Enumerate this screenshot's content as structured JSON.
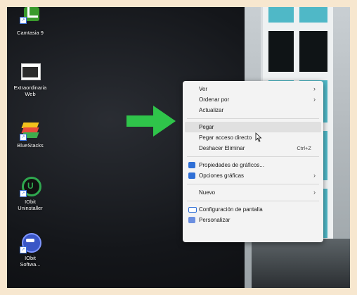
{
  "desktop_icons": [
    {
      "label": "Camtasia 9",
      "icon": "camtasia-icon"
    },
    {
      "label": "Extraordinaria\nWeb",
      "icon": "window-icon"
    },
    {
      "label": "BlueStacks",
      "icon": "bluestacks-icon"
    },
    {
      "label": "IObit\nUninstaller",
      "icon": "iobit-uninstaller-icon"
    },
    {
      "label": "IObit\nSoftwa...",
      "icon": "iobit-software-icon"
    }
  ],
  "context_menu": {
    "items": [
      {
        "label": "Ver",
        "submenu": true
      },
      {
        "label": "Ordenar por",
        "submenu": true
      },
      {
        "label": "Actualizar"
      },
      {
        "label": "Pegar",
        "highlighted": true
      },
      {
        "label": "Pegar acceso directo"
      },
      {
        "label": "Deshacer Eliminar",
        "shortcut": "Ctrl+Z"
      },
      {
        "label": "Propiedades de gráficos...",
        "icon": "intel-graphics-icon"
      },
      {
        "label": "Opciones gráficas",
        "icon": "intel-graphics-icon",
        "submenu": true
      },
      {
        "label": "Nuevo",
        "submenu": true
      },
      {
        "label": "Configuración de pantalla",
        "icon": "display-icon"
      },
      {
        "label": "Personalizar",
        "icon": "personalize-icon"
      }
    ]
  },
  "colors": {
    "arrow": "#2fc44a",
    "accent": "#2f6fd6"
  }
}
